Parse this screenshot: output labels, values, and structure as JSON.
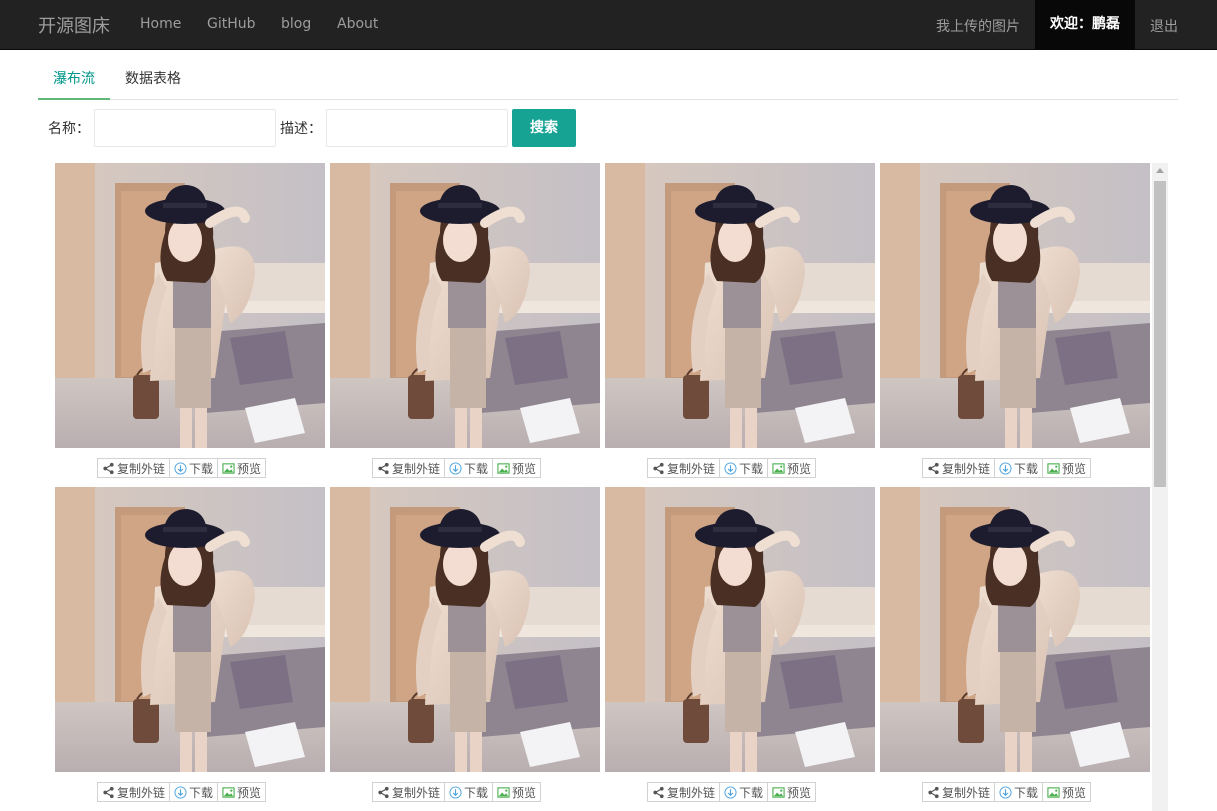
{
  "navbar": {
    "brand": "开源图床",
    "links": [
      "Home",
      "GitHub",
      "blog",
      "About"
    ],
    "my_images": "我上传的图片",
    "welcome": "欢迎：鹏磊",
    "logout": "退出"
  },
  "tabs": [
    "瀑布流",
    "数据表格"
  ],
  "search": {
    "name_label": "名称：",
    "desc_label": "描述：",
    "name_value": "",
    "desc_value": "",
    "button": "搜索"
  },
  "card_actions": {
    "copy_link": "复制外链",
    "download": "下载",
    "preview": "预览"
  },
  "colors": {
    "navbar_bg": "#222222",
    "accent": "#009688",
    "search_button": "#16a394"
  },
  "icons": [
    "share-icon",
    "download-icon",
    "image-icon"
  ]
}
